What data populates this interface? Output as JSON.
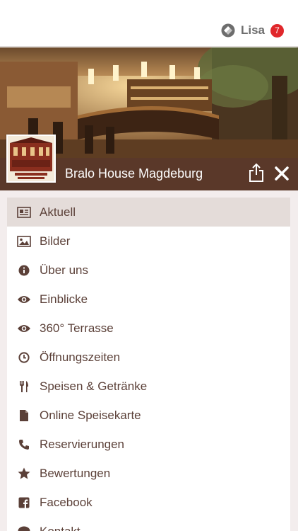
{
  "header": {
    "user_name": "Lisa",
    "notification_count": "7"
  },
  "venue": {
    "title": "Bralo House Magdeburg"
  },
  "menu": [
    {
      "label": "Aktuell",
      "icon": "newspaper-icon",
      "active": true
    },
    {
      "label": "Bilder",
      "icon": "image-icon"
    },
    {
      "label": "Über uns",
      "icon": "info-icon"
    },
    {
      "label": "Einblicke",
      "icon": "eye-icon"
    },
    {
      "label": "360° Terrasse",
      "icon": "eye-icon"
    },
    {
      "label": "Öffnungszeiten",
      "icon": "clock-icon"
    },
    {
      "label": "Speisen & Getränke",
      "icon": "cutlery-icon"
    },
    {
      "label": "Online Speisekarte",
      "icon": "document-icon"
    },
    {
      "label": "Reservierungen",
      "icon": "phone-icon"
    },
    {
      "label": "Bewertungen",
      "icon": "star-icon"
    },
    {
      "label": "Facebook",
      "icon": "facebook-icon"
    },
    {
      "label": "Kontakt",
      "icon": "chat-icon"
    }
  ],
  "colors": {
    "brown": "#5a3829",
    "active_row": "#e4dcd9",
    "badge_red": "#e0272b"
  }
}
